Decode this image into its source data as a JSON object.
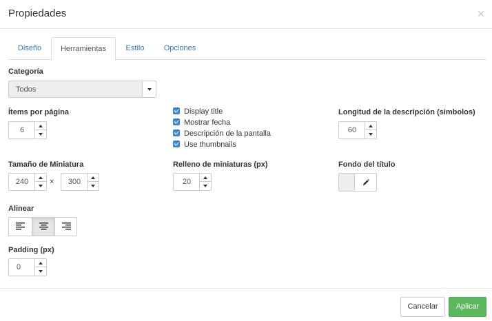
{
  "dialog": {
    "title": "Propiedades"
  },
  "tabs": [
    {
      "label": "Diseño",
      "active": false
    },
    {
      "label": "Herramientas",
      "active": true
    },
    {
      "label": "Estilo",
      "active": false
    },
    {
      "label": "Opciones",
      "active": false
    }
  ],
  "fields": {
    "categoria": {
      "label": "Categoría",
      "value": "Todos"
    },
    "items_por_pagina": {
      "label": "Ítems por página",
      "value": "6"
    },
    "longitud_descripcion": {
      "label": "Longitud de la descripción (simbolos)",
      "value": "60"
    },
    "tamano_miniatura": {
      "label": "Tamaño de Miniatura",
      "width": "240",
      "height": "300",
      "separator": "×"
    },
    "relleno_miniaturas": {
      "label": "Relleno de miniaturas (px)",
      "value": "20"
    },
    "fondo_titulo": {
      "label": "Fondo del título",
      "color": "#eeeeee"
    },
    "alinear": {
      "label": "Alinear",
      "selected": "center"
    },
    "padding": {
      "label": "Padding (px)",
      "value": "0"
    }
  },
  "checkboxes": [
    {
      "label": "Display title",
      "checked": true
    },
    {
      "label": "Mostrar fecha",
      "checked": true
    },
    {
      "label": "Descripción de la pantalla",
      "checked": true
    },
    {
      "label": "Use thumbnails",
      "checked": true
    }
  ],
  "footer": {
    "cancel_label": "Cancelar",
    "apply_label": "Aplicar"
  },
  "colors": {
    "link": "#337ab7",
    "checkbox": "#3d88d6",
    "apply": "#5cb85c"
  },
  "icons": {
    "close": "close-icon",
    "pencil": "pencil-icon",
    "align_left": "align-left-icon",
    "align_center": "align-center-icon",
    "align_right": "align-right-icon"
  }
}
